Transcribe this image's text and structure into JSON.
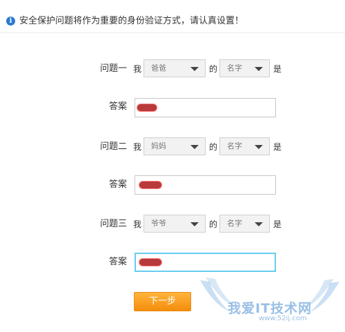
{
  "notice": {
    "icon": "info-icon",
    "text": "安全保护问题将作为重要的身份验证方式，请认真设置！"
  },
  "questions": [
    {
      "label": "问题一",
      "prefix": "我",
      "relation": "爸爸",
      "connector": "的",
      "attribute": "名字",
      "suffix": "是",
      "answer_label": "答案",
      "answer_value": ""
    },
    {
      "label": "问题二",
      "prefix": "我",
      "relation": "妈妈",
      "connector": "的",
      "attribute": "名字",
      "suffix": "是",
      "answer_label": "答案",
      "answer_value": ""
    },
    {
      "label": "问题三",
      "prefix": "我",
      "relation": "爷爷",
      "connector": "的",
      "attribute": "名字",
      "suffix": "是",
      "answer_label": "答案",
      "answer_value": ""
    }
  ],
  "actions": {
    "next_label": "下一步"
  },
  "watermark": {
    "title": "我爱IT技术网",
    "url": "www.52ij.com"
  },
  "colors": {
    "accent": "#f7940f",
    "info": "#2a7ad0",
    "focus": "#66ccee",
    "redaction": "#b93a3a"
  }
}
